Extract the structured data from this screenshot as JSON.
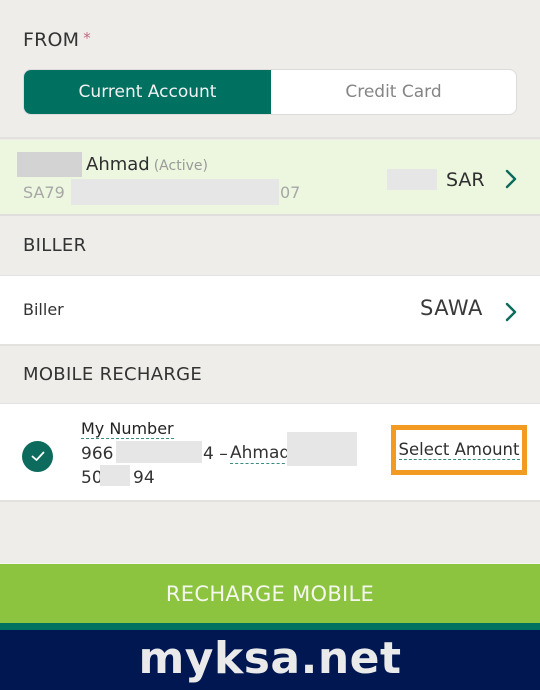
{
  "from": {
    "label": "FROM",
    "required_marker": "*",
    "tabs": [
      {
        "label": "Current Account",
        "active": true
      },
      {
        "label": "Credit Card",
        "active": false
      }
    ]
  },
  "account": {
    "name": "Ahmad",
    "status": "(Active)",
    "iban_prefix": "SA79",
    "iban_suffix": "07",
    "currency": "SAR"
  },
  "biller_section": {
    "header": "BILLER",
    "label": "Biller",
    "value": "SAWA"
  },
  "mobile_recharge": {
    "header": "MOBILE RECHARGE",
    "selected": true,
    "title": "My Number",
    "number_prefix": "966",
    "number_suffix": "4 –",
    "owner_name": "Ahmad",
    "line3_prefix": "50",
    "line3_suffix": "94",
    "select_amount_label": "Select Amount"
  },
  "actions": {
    "recharge_label": "RECHARGE MOBILE"
  },
  "watermark": {
    "text": "myksa.net"
  },
  "colors": {
    "primary_teal": "#007060",
    "action_green": "#8cc43f",
    "highlight_orange": "#f39a22",
    "brand_navy": "#001751",
    "account_bg": "#edf7df"
  }
}
